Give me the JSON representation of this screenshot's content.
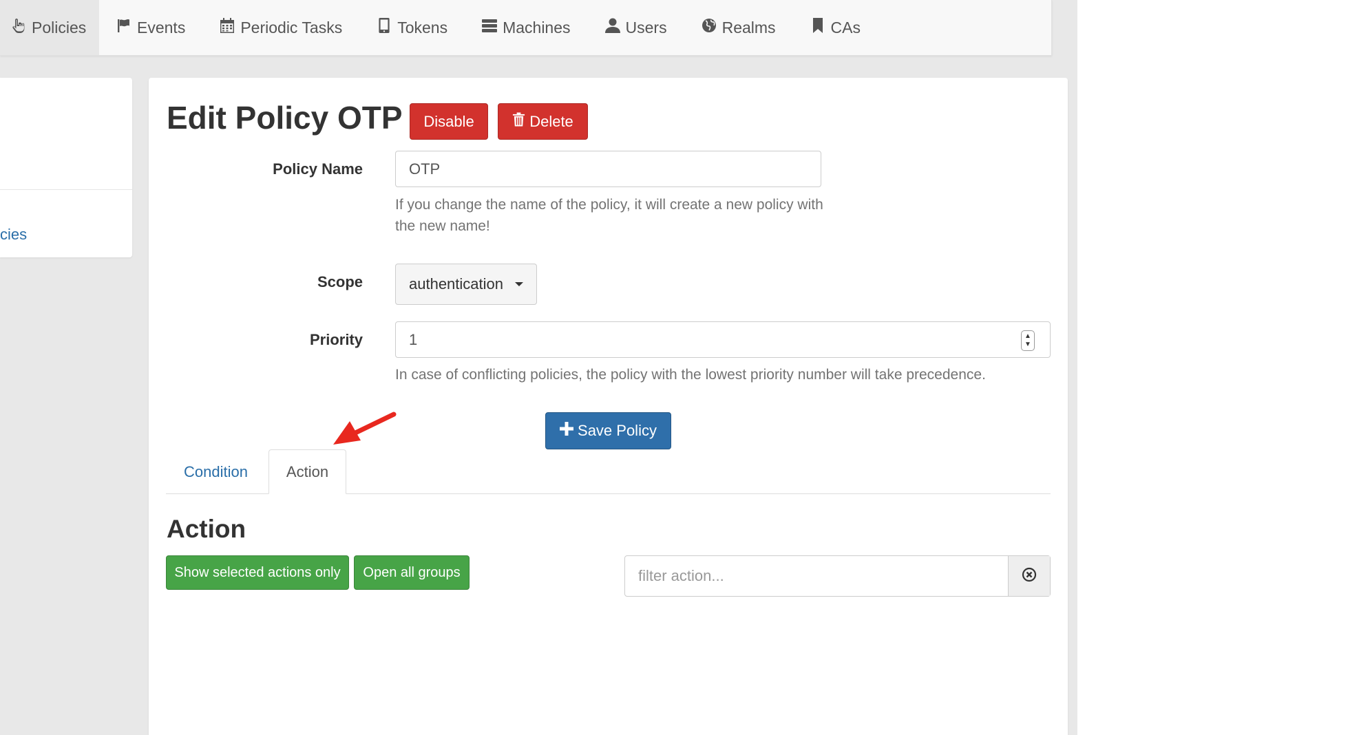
{
  "nav": {
    "items": [
      {
        "label": "Policies",
        "icon": "hand-pointer-icon"
      },
      {
        "label": "Events",
        "icon": "flag-icon"
      },
      {
        "label": "Periodic Tasks",
        "icon": "calendar-icon"
      },
      {
        "label": "Tokens",
        "icon": "phone-icon"
      },
      {
        "label": "Machines",
        "icon": "server-icon"
      },
      {
        "label": "Users",
        "icon": "user-icon"
      },
      {
        "label": "Realms",
        "icon": "globe-icon"
      },
      {
        "label": "CAs",
        "icon": "bookmark-icon"
      }
    ],
    "active": "Policies"
  },
  "sidebar": {
    "link_label": "cies"
  },
  "page": {
    "title": "Edit Policy OTP",
    "disable_label": "Disable",
    "delete_label": "Delete"
  },
  "form": {
    "policy_name_label": "Policy Name",
    "policy_name_value": "OTP",
    "policy_name_help": "If you change the name of the policy, it will create a new policy with the new name!",
    "scope_label": "Scope",
    "scope_value": "authentication",
    "priority_label": "Priority",
    "priority_value": "1",
    "priority_help": "In case of conflicting policies, the policy with the lowest priority number will take precedence.",
    "save_label": "Save Policy"
  },
  "tabs": {
    "items": [
      "Condition",
      "Action"
    ],
    "active": "Action"
  },
  "action_section": {
    "title": "Action",
    "show_selected_label": "Show selected actions only",
    "open_groups_label": "Open all groups",
    "filter_placeholder": "filter action..."
  },
  "colors": {
    "danger": "#d2322d",
    "primary": "#2f6faa",
    "success": "#47a447",
    "link": "#2a6ea8",
    "annotation_arrow": "#e8281f"
  }
}
